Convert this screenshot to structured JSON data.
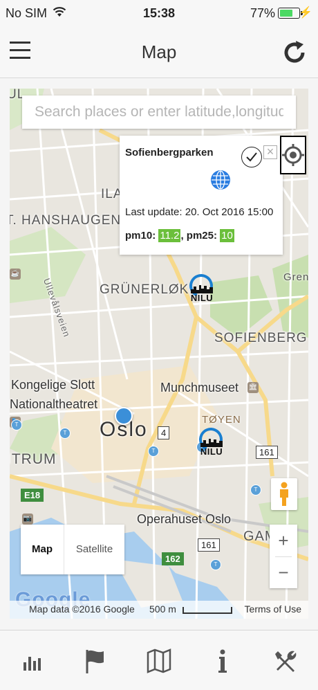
{
  "status_bar": {
    "carrier": "No SIM",
    "time": "15:38",
    "battery": "77%",
    "battery_level": 0.77
  },
  "nav": {
    "title": "Map"
  },
  "search": {
    "placeholder": "Search places or enter latitude,longitude"
  },
  "map_labels": {
    "hanshaugen": "T. HANSHAUGEN",
    "ila": "ILA",
    "grunerlokka": "GRÜNERLØK",
    "sofienberg": "SOFIENBERG",
    "slott": "Kongelige Slott",
    "nationaltheatret": "Nationaltheatret",
    "munch": "Munchmuseet",
    "toyen": "TØYEN",
    "oslo": "Oslo",
    "sentrum": "ITRUM",
    "opera": "Operahuset Oslo",
    "gamle": "GAM",
    "grens": "Grens",
    "ullevaal": "Ullevålsveien",
    "ul": "UL"
  },
  "road_shields": {
    "r4": "4",
    "r161a": "161",
    "e18": "E18",
    "r162": "162",
    "r161b": "161"
  },
  "stations": [
    {
      "label": "NILU"
    },
    {
      "label": "NILU"
    }
  ],
  "popup": {
    "station": "Sofienbergparken",
    "last_update_label": "Last update:",
    "last_update": "20. Oct 2016 15:00",
    "pm10_label": "pm10",
    "pm10_value": "11.2",
    "pm25_label": "pm25",
    "pm25_value": "10",
    "value_color": "#6bbf3b"
  },
  "map_type": {
    "map": "Map",
    "satellite": "Satellite",
    "selected": "Map"
  },
  "zoom": {
    "in": "+",
    "out": "−"
  },
  "attribution": {
    "google": "Google",
    "data": "Map data ©2016 Google",
    "scale": "500 m",
    "terms": "Terms of Use"
  },
  "tabs": [
    {
      "icon": "bar-chart-icon"
    },
    {
      "icon": "flag-icon"
    },
    {
      "icon": "map-icon"
    },
    {
      "icon": "info-icon"
    },
    {
      "icon": "tools-icon"
    }
  ]
}
